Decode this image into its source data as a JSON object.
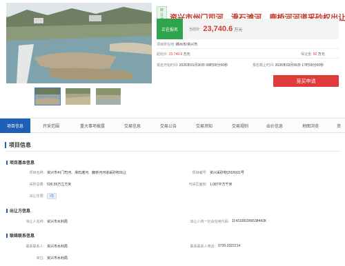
{
  "listing": {
    "type_badge": "转让项目",
    "title": "资兴市州门司河、滑石滩河、鹿桥河河道采砂权出让",
    "status": "正在报名",
    "price_label": "当前价:",
    "price_value": "23,740.6",
    "price_unit": "万元",
    "location_label": "项目所在地:",
    "location_value": "郴州市/资兴市",
    "start_price_label": "起始价:",
    "start_price_value": "23,740.6",
    "start_price_unit": "万元",
    "deposit_label": "保证金:",
    "deposit_value": "50",
    "deposit_unit": "万元",
    "reg_start_label": "报名开始时间:",
    "reg_start_value": "2026年01月30日 08时00分00秒",
    "reg_end_label": "报名截止时间:",
    "reg_end_value": "2026年03月06日 17时00分00秒",
    "apply_button": "竞买申请"
  },
  "tabs": [
    {
      "label": "项目信息",
      "active": true
    },
    {
      "label": "开采范围",
      "active": false
    },
    {
      "label": "重大事项披露",
      "active": false
    },
    {
      "label": "交易信息",
      "active": false
    },
    {
      "label": "交易公告",
      "active": false
    },
    {
      "label": "交易须知",
      "active": false
    },
    {
      "label": "交易规则",
      "active": false
    },
    {
      "label": "出价信息",
      "active": false
    },
    {
      "label": "地图浏览",
      "active": false
    },
    {
      "label": "资",
      "active": false
    }
  ],
  "project_section": {
    "title": "项目信息",
    "basic": {
      "heading": "项目基本信息",
      "name_label": "项目名称:",
      "name_value": "资兴市州门司河、滑石滩河、鹿桥河河道采砂权出让",
      "code_label": "项目编号:",
      "code_value": "资兴采砂权(2026)01号",
      "volume_label": "采砂总量:",
      "volume_value": "536.55万立方米",
      "area_label": "可采区面积:",
      "area_value": "1.087平方千米",
      "period_label": "出让年限:",
      "period_value": "/年"
    },
    "seller": {
      "heading": "出让方信息",
      "name_label": "出让人名称:",
      "name_value": "资兴市水利局",
      "credit_label": "出让人统一社会信用代码:",
      "credit_value": "11431081006538442K"
    },
    "contact": {
      "heading": "联络联系信息",
      "person_label": "联系联系人:",
      "person_value": "资兴市水利局",
      "phone_label": "联系联系人电话:",
      "phone_value": "0735-3322214",
      "unit_label": "单位:",
      "unit_value": "资兴市水利局"
    }
  },
  "colors": {
    "accent": "#1f5fb5",
    "price_red": "#d43a2f",
    "status_green": "#2fa44f",
    "button_red": "#e03b3b"
  }
}
